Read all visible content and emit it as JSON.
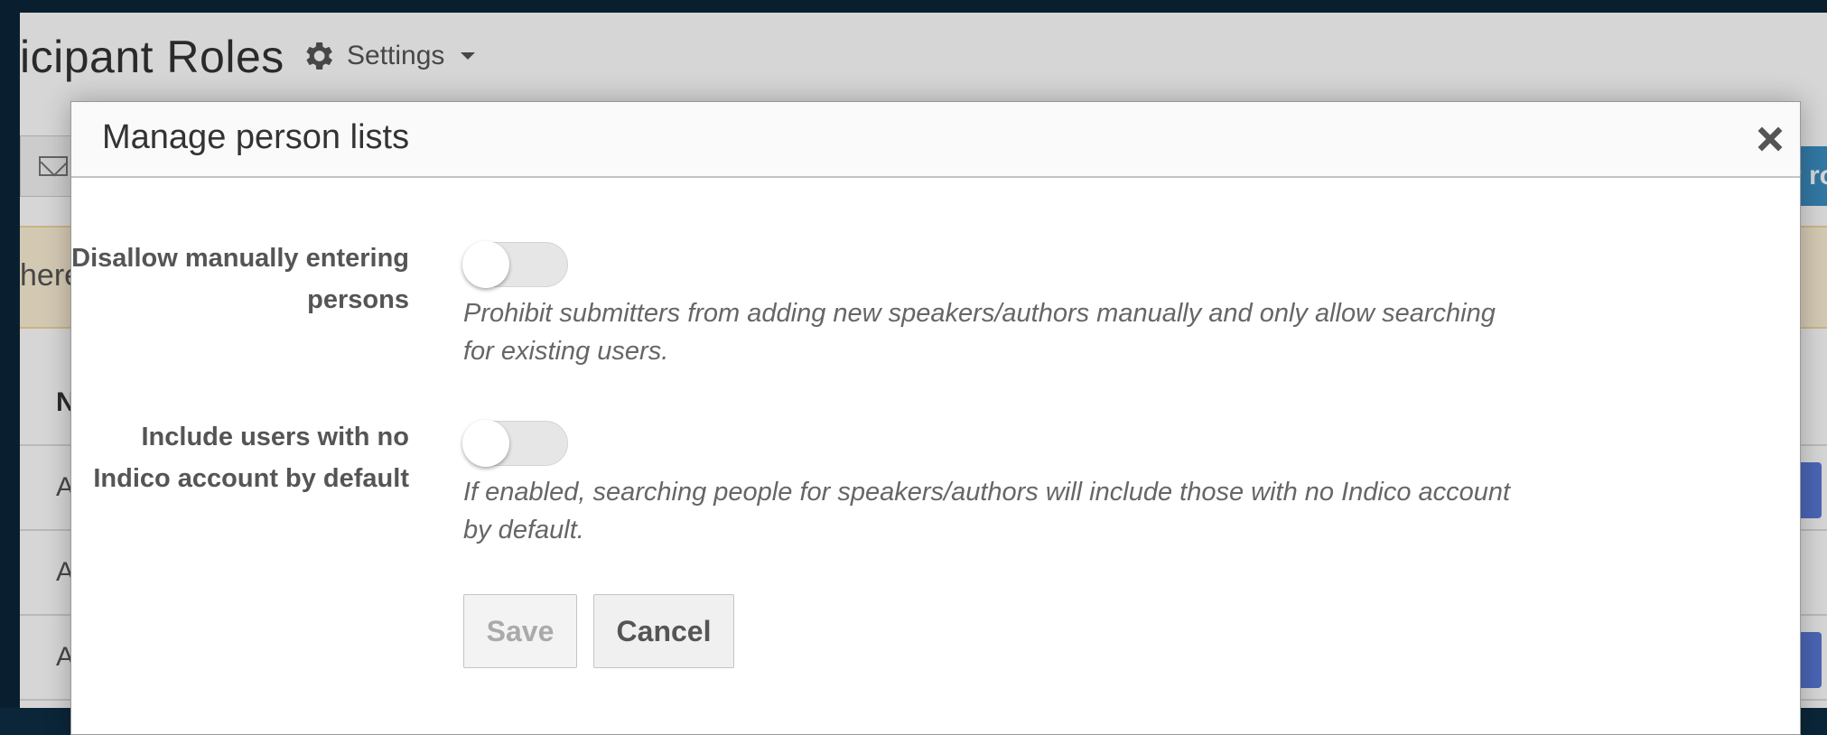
{
  "background": {
    "page_title": "icipant Roles",
    "settings_label": "Settings",
    "action_button_partial": "r ro",
    "warning_partial": "here",
    "table_header_partial": "N",
    "row_partial": [
      "A",
      "A",
      "A"
    ]
  },
  "modal": {
    "title": "Manage person lists",
    "fields": [
      {
        "label": "Disallow manually entering persons",
        "help": "Prohibit submitters from adding new speakers/authors manually and only allow searching for existing users.",
        "enabled": false
      },
      {
        "label": "Include users with no Indico account by default",
        "help": "If enabled, searching people for speakers/authors will include those with no Indico account by default.",
        "enabled": false
      }
    ],
    "save_label": "Save",
    "cancel_label": "Cancel"
  },
  "icons": {
    "settings": "gear-icon",
    "close": "close-icon",
    "email": "envelope-icon",
    "dropdown": "caret-down-icon"
  },
  "colors": {
    "page_frame": "#0b2638",
    "primary_button": "#3b8fc4",
    "warning_bg": "#fcf0d6",
    "row_button": "#5a79d8"
  }
}
